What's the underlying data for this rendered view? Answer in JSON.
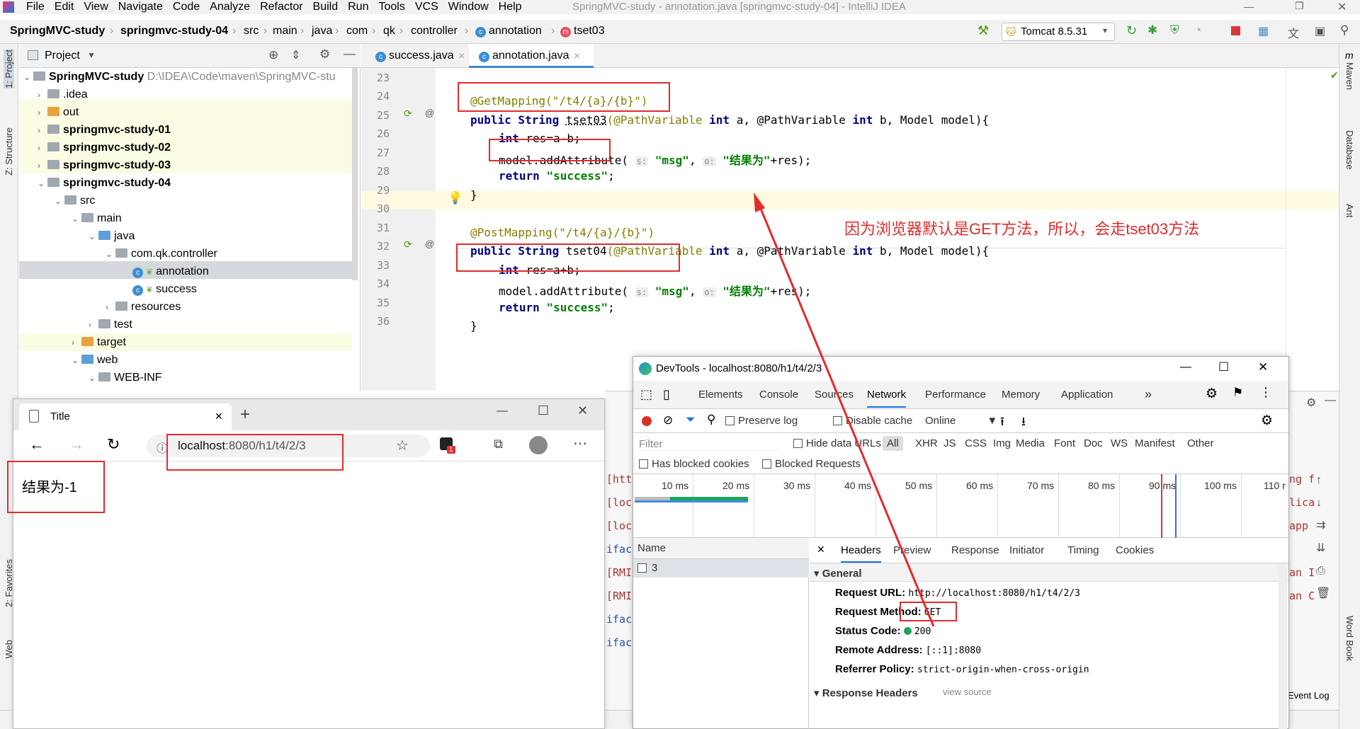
{
  "menu": [
    "File",
    "Edit",
    "View",
    "Navigate",
    "Code",
    "Analyze",
    "Refactor",
    "Build",
    "Run",
    "Tools",
    "VCS",
    "Window",
    "Help"
  ],
  "window_title": "SpringMVC-study - annotation.java [springmvc-study-04] - IntelliJ IDEA",
  "breadcrumbs": [
    "SpringMVC-study",
    "springmvc-study-04",
    "src",
    "main",
    "java",
    "com",
    "qk",
    "controller",
    "annotation",
    "tset03"
  ],
  "run_config": "Tomcat 8.5.31",
  "left_tools": {
    "project": "1: Project",
    "structure": "Z: Structure",
    "favorites": "2: Favorites",
    "web": "Web"
  },
  "right_tools": {
    "maven": "Maven",
    "database": "Database",
    "ant": "Ant",
    "wordbook": "Word Book"
  },
  "project_panel": {
    "title": "Project",
    "tree": [
      {
        "label": "SpringMVC-study",
        "path": "D:\\IDEA\\Code\\maven\\SpringMVC-stu"
      },
      {
        "label": ".idea"
      },
      {
        "label": "out"
      },
      {
        "label": "springmvc-study-01"
      },
      {
        "label": "springmvc-study-02"
      },
      {
        "label": "springmvc-study-03"
      },
      {
        "label": "springmvc-study-04"
      },
      {
        "label": "src"
      },
      {
        "label": "main"
      },
      {
        "label": "java"
      },
      {
        "label": "com.qk.controller"
      },
      {
        "label": "annotation"
      },
      {
        "label": "success"
      },
      {
        "label": "resources"
      },
      {
        "label": "test"
      },
      {
        "label": "target"
      },
      {
        "label": "web"
      },
      {
        "label": "WEB-INF"
      }
    ]
  },
  "editor_tabs": [
    "success.java",
    "annotation.java"
  ],
  "line_numbers": [
    "23",
    "24",
    "25",
    "26",
    "27",
    "28",
    "29",
    "30",
    "31",
    "32",
    "33",
    "34",
    "35",
    "36"
  ],
  "code": {
    "l24": "@GetMapping(\"/t4/{a}/{b}\")",
    "l25a": "public String ",
    "l25b": "tset03",
    "l25c": "(@PathVariable ",
    "l25d": "int",
    "l25e": " a, @PathVariable ",
    "l25f": "int",
    "l25g": " b, Model model){",
    "l26a": "int",
    "l26b": " res=a-b;",
    "l27a": "model.addAttribute(",
    "l27h1": "s:",
    "l27s1": "\"msg\"",
    "l27h2": "o:",
    "l27s2": "\"结果为\"",
    "l27e": "+res);",
    "l28a": "return ",
    "l28b": "\"success\"",
    "l28c": ";",
    "l29": "}",
    "l31": "@PostMapping(\"/t4/{a}/{b}\")",
    "l32a": "public String ",
    "l32b": "tset04",
    "l32c": "(@PathVariable ",
    "l32d": "int",
    "l32e": " a, @PathVariable ",
    "l32f": "int",
    "l32g": " b, Model model){",
    "l33a": "int",
    "l33b": " res=a+b;",
    "l34a": "model.addAttribute(",
    "l34h1": "s:",
    "l34s1": "\"msg\"",
    "l34h2": "o:",
    "l34s2": "\"结果为\"",
    "l34e": "+res);",
    "l35a": "return ",
    "l35b": "\"success\"",
    "l35c": ";",
    "l36": "}"
  },
  "annotation_note": "因为浏览器默认是GET方法，所以，会走tset03方法",
  "browser": {
    "tab_title": "Title",
    "address": "localhost:8080/h1/t4/2/3",
    "address_host": "localhost",
    "address_rest": ":8080/h1/t4/2/3",
    "content": "结果为-1",
    "badge": "1"
  },
  "console_lines": [
    "[htt",
    "[loc",
    "[loc",
    "ifac",
    "[RMI",
    "[RMI",
    "ifac",
    "ifac"
  ],
  "console_right": [
    "ng f",
    "lica",
    "app",
    "an I",
    "an C"
  ],
  "devtools": {
    "title": "DevTools - localhost:8080/h1/t4/2/3",
    "tabs": [
      "Elements",
      "Console",
      "Sources",
      "Network",
      "Performance",
      "Memory",
      "Application",
      "»"
    ],
    "toolbar": {
      "preserve_log": "Preserve log",
      "disable_cache": "Disable cache",
      "throttle": "Online"
    },
    "filter_placeholder": "Filter",
    "hide_data_urls": "Hide data URLs",
    "types": [
      "All",
      "XHR",
      "JS",
      "CSS",
      "Img",
      "Media",
      "Font",
      "Doc",
      "WS",
      "Manifest",
      "Other"
    ],
    "blocked_cookies": "Has blocked cookies",
    "blocked_requests": "Blocked Requests",
    "timeline_ticks": [
      "10 ms",
      "20 ms",
      "30 ms",
      "40 ms",
      "50 ms",
      "60 ms",
      "70 ms",
      "80 ms",
      "90 ms",
      "100 ms",
      "110 r"
    ],
    "name_header": "Name",
    "request_name": "3",
    "detail_tabs": [
      "Headers",
      "Preview",
      "Response",
      "Initiator",
      "Timing",
      "Cookies"
    ],
    "general_title": "General",
    "general": [
      {
        "k": "Request URL:",
        "v": "http://localhost:8080/h1/t4/2/3"
      },
      {
        "k": "Request Method:",
        "v": "GET"
      },
      {
        "k": "Status Code:",
        "v": "200"
      },
      {
        "k": "Remote Address:",
        "v": "[::1]:8080"
      },
      {
        "k": "Referrer Policy:",
        "v": "strict-origin-when-cross-origin"
      }
    ],
    "response_headers": "Response Headers",
    "view_source": "view source"
  },
  "event_log": "Event Log",
  "colors": {
    "annotation_red": "#e32b2b",
    "accent_blue": "#4a88c7"
  }
}
